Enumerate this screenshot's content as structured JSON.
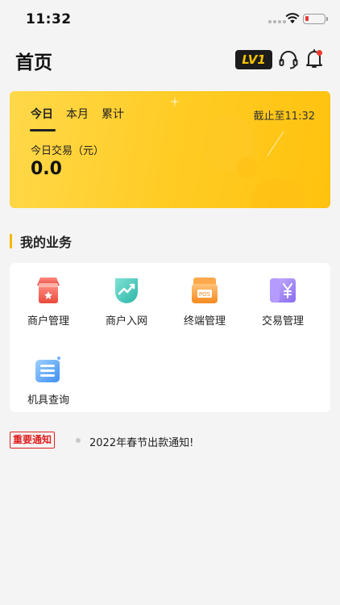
{
  "status_bar": {
    "time": "11:32"
  },
  "header": {
    "title": "首页",
    "level_badge": "LV1"
  },
  "stats_card": {
    "tabs": [
      "今日",
      "本月",
      "累计"
    ],
    "active_tab": "今日",
    "cutoff_text": "截止至11:32",
    "metric_label": "今日交易（元）",
    "metric_value": "0.0"
  },
  "business": {
    "section_title": "我的业务",
    "items": [
      {
        "label": "商户管理",
        "icon": "merchant-shop-icon"
      },
      {
        "label": "商户入网",
        "icon": "merchant-onboard-icon"
      },
      {
        "label": "终端管理",
        "icon": "pos-terminal-icon"
      },
      {
        "label": "交易管理",
        "icon": "transaction-yen-icon"
      },
      {
        "label": "机具查询",
        "icon": "device-query-icon"
      }
    ]
  },
  "notice": {
    "badge": "重要通知",
    "text": "2022年春节出款通知!"
  },
  "colors": {
    "accent": "#ffc20e",
    "notice_red": "#e02020",
    "background": "#f4f4f4"
  }
}
